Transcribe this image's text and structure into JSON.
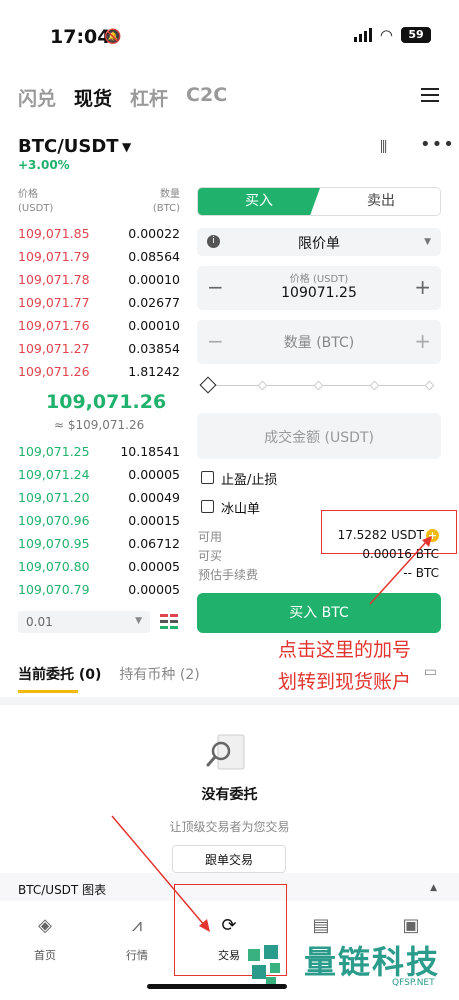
{
  "status": {
    "time": "17:04",
    "battery": "59"
  },
  "tabs": [
    "闪兑",
    "现货",
    "杠杆",
    "C2C"
  ],
  "pair": {
    "name": "BTC/USDT",
    "change": "+3.00%"
  },
  "orderbook": {
    "price_head": [
      "价格",
      "(USDT)"
    ],
    "qty_head": [
      "数量",
      "(BTC)"
    ],
    "asks": [
      [
        "109,071.85",
        "0.00022"
      ],
      [
        "109,071.79",
        "0.08564"
      ],
      [
        "109,071.78",
        "0.00010"
      ],
      [
        "109,071.77",
        "0.02677"
      ],
      [
        "109,071.76",
        "0.00010"
      ],
      [
        "109,071.27",
        "0.03854"
      ],
      [
        "109,071.26",
        "1.81242"
      ]
    ],
    "mid_price": "109,071.26",
    "mid_sub": "≈ $109,071.26",
    "bids": [
      [
        "109,071.25",
        "10.18541"
      ],
      [
        "109,071.24",
        "0.00005"
      ],
      [
        "109,071.20",
        "0.00049"
      ],
      [
        "109,070.96",
        "0.00015"
      ],
      [
        "109,070.95",
        "0.06712"
      ],
      [
        "109,070.80",
        "0.00005"
      ],
      [
        "109,070.79",
        "0.00005"
      ]
    ],
    "step": "0.01"
  },
  "trade": {
    "buy_label": "买入",
    "sell_label": "卖出",
    "order_type": "限价单",
    "price_label": "价格 (USDT)",
    "price_value": "109071.25",
    "qty_label": "数量 (BTC)",
    "amount_label": "成交金额 (USDT)",
    "tp_sl": "止盈/止损",
    "iceberg": "冰山单",
    "available_label": "可用",
    "available_value": "17.5282 USDT",
    "buyable_label": "可买",
    "buyable_value": "0.00016 BTC",
    "fee_label": "预估手续费",
    "fee_value": "-- BTC",
    "buy_button": "买入 BTC"
  },
  "annotation": [
    "点击这里的加号",
    "划转到现货账户"
  ],
  "orders": {
    "tab_current": "当前委托 (0)",
    "tab_holdings": "持有币种 (2)",
    "empty_title": "没有委托",
    "empty_sub": "让顶级交易者为您交易",
    "follow_button": "跟单交易"
  },
  "chart_bar": "BTC/USDT 图表",
  "nav": [
    "首页",
    "行情",
    "交易",
    "",
    ""
  ],
  "watermark": {
    "text": "量链科技",
    "sub": "QFSP.NET"
  },
  "colors": {
    "green": "#20b26c",
    "red": "#e0454f",
    "accent": "#f2b90c",
    "annotation": "#e3342f"
  }
}
